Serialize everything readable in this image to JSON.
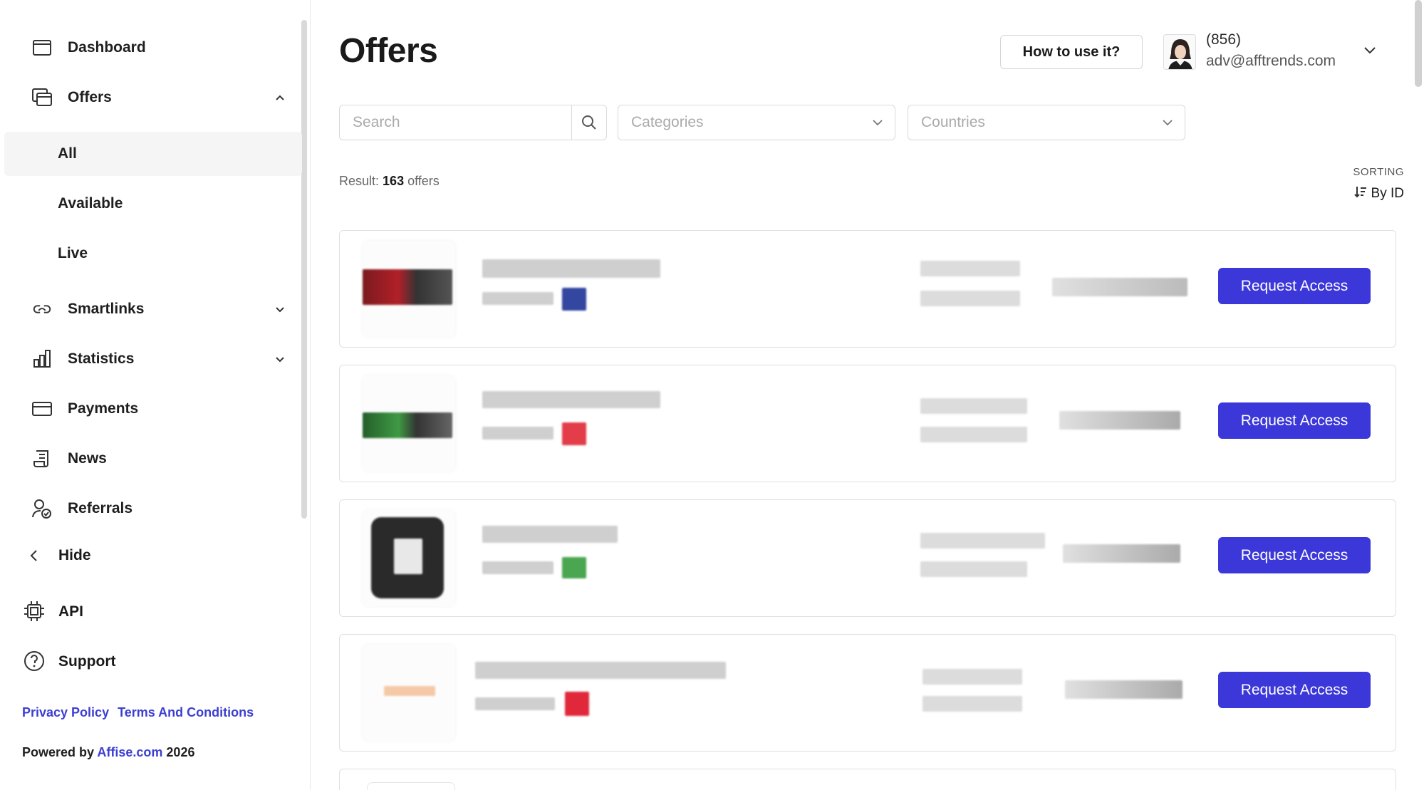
{
  "sidebar": {
    "items": [
      {
        "label": "Dashboard",
        "icon": "dashboard-icon"
      },
      {
        "label": "Offers",
        "icon": "offers-icon",
        "expanded": true
      },
      {
        "label": "Smartlinks",
        "icon": "link-icon"
      },
      {
        "label": "Statistics",
        "icon": "bar-chart-icon"
      },
      {
        "label": "Payments",
        "icon": "card-icon"
      },
      {
        "label": "News",
        "icon": "news-icon"
      },
      {
        "label": "Referrals",
        "icon": "referrals-icon"
      }
    ],
    "offers_sub": [
      {
        "label": "All",
        "active": true
      },
      {
        "label": "Available"
      },
      {
        "label": "Live"
      }
    ],
    "hide_label": "Hide",
    "api_label": "API",
    "support_label": "Support",
    "privacy": "Privacy Policy",
    "terms": "Terms And Conditions",
    "powered_prefix": "Powered by",
    "powered_link": "Affise.com",
    "powered_year": "2026"
  },
  "header": {
    "title": "Offers",
    "how_to_btn": "How to use it?",
    "user_phone": "(856)",
    "user_email": "adv@afftrends.com"
  },
  "filters": {
    "search_placeholder": "Search",
    "categories_placeholder": "Categories",
    "countries_placeholder": "Countries"
  },
  "result": {
    "prefix": "Result:",
    "count": "163",
    "suffix": "offers"
  },
  "sorting": {
    "label": "SORTING",
    "value": "By ID"
  },
  "offers": [
    {
      "action": "Request Access",
      "thumb_color": "#8b1f24",
      "flag_color": "#2b3f9a"
    },
    {
      "action": "Request Access",
      "thumb_color": "#2f7a3a",
      "flag_color": "#e23d48"
    },
    {
      "action": "Request Access",
      "thumb_color": "#2a2a2a",
      "flag_color": "#4aa651"
    },
    {
      "action": "Request Access",
      "thumb_color": "#f5c9a8",
      "flag_color": "#e0283a"
    }
  ],
  "colors": {
    "accent": "#3c37d9",
    "link": "#3b3fd1"
  }
}
